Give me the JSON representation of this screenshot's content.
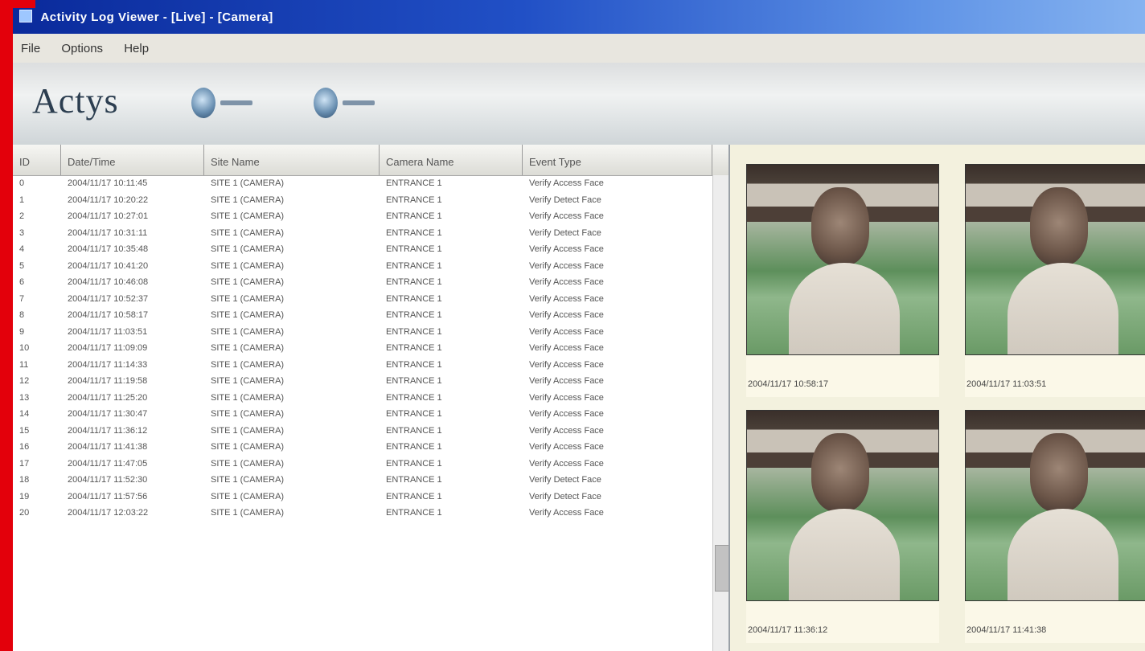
{
  "window": {
    "title": "Activity Log Viewer - [Live] - [Camera]"
  },
  "menu": [
    "File",
    "Options",
    "Help"
  ],
  "toolbar": {
    "logo": "Actys"
  },
  "columns": [
    "ID",
    "Date/Time",
    "Site Name",
    "Camera Name",
    "Event Type"
  ],
  "rows": [
    {
      "id": "0",
      "datetime": "2004/11/17 10:11:45",
      "site": "SITE 1 (CAMERA)",
      "camera": "ENTRANCE 1",
      "event": "Verify Access Face"
    },
    {
      "id": "1",
      "datetime": "2004/11/17 10:20:22",
      "site": "SITE 1 (CAMERA)",
      "camera": "ENTRANCE 1",
      "event": "Verify Detect Face"
    },
    {
      "id": "2",
      "datetime": "2004/11/17 10:27:01",
      "site": "SITE 1 (CAMERA)",
      "camera": "ENTRANCE 1",
      "event": "Verify Access Face"
    },
    {
      "id": "3",
      "datetime": "2004/11/17 10:31:11",
      "site": "SITE 1 (CAMERA)",
      "camera": "ENTRANCE 1",
      "event": "Verify Detect Face"
    },
    {
      "id": "4",
      "datetime": "2004/11/17 10:35:48",
      "site": "SITE 1 (CAMERA)",
      "camera": "ENTRANCE 1",
      "event": "Verify Access Face"
    },
    {
      "id": "5",
      "datetime": "2004/11/17 10:41:20",
      "site": "SITE 1 (CAMERA)",
      "camera": "ENTRANCE 1",
      "event": "Verify Access Face"
    },
    {
      "id": "6",
      "datetime": "2004/11/17 10:46:08",
      "site": "SITE 1 (CAMERA)",
      "camera": "ENTRANCE 1",
      "event": "Verify Access Face"
    },
    {
      "id": "7",
      "datetime": "2004/11/17 10:52:37",
      "site": "SITE 1 (CAMERA)",
      "camera": "ENTRANCE 1",
      "event": "Verify Access Face"
    },
    {
      "id": "8",
      "datetime": "2004/11/17 10:58:17",
      "site": "SITE 1 (CAMERA)",
      "camera": "ENTRANCE 1",
      "event": "Verify Access Face"
    },
    {
      "id": "9",
      "datetime": "2004/11/17 11:03:51",
      "site": "SITE 1 (CAMERA)",
      "camera": "ENTRANCE 1",
      "event": "Verify Access Face"
    },
    {
      "id": "10",
      "datetime": "2004/11/17 11:09:09",
      "site": "SITE 1 (CAMERA)",
      "camera": "ENTRANCE 1",
      "event": "Verify Access Face"
    },
    {
      "id": "11",
      "datetime": "2004/11/17 11:14:33",
      "site": "SITE 1 (CAMERA)",
      "camera": "ENTRANCE 1",
      "event": "Verify Access Face"
    },
    {
      "id": "12",
      "datetime": "2004/11/17 11:19:58",
      "site": "SITE 1 (CAMERA)",
      "camera": "ENTRANCE 1",
      "event": "Verify Access Face"
    },
    {
      "id": "13",
      "datetime": "2004/11/17 11:25:20",
      "site": "SITE 1 (CAMERA)",
      "camera": "ENTRANCE 1",
      "event": "Verify Access Face"
    },
    {
      "id": "14",
      "datetime": "2004/11/17 11:30:47",
      "site": "SITE 1 (CAMERA)",
      "camera": "ENTRANCE 1",
      "event": "Verify Access Face"
    },
    {
      "id": "15",
      "datetime": "2004/11/17 11:36:12",
      "site": "SITE 1 (CAMERA)",
      "camera": "ENTRANCE 1",
      "event": "Verify Access Face"
    },
    {
      "id": "16",
      "datetime": "2004/11/17 11:41:38",
      "site": "SITE 1 (CAMERA)",
      "camera": "ENTRANCE 1",
      "event": "Verify Access Face"
    },
    {
      "id": "17",
      "datetime": "2004/11/17 11:47:05",
      "site": "SITE 1 (CAMERA)",
      "camera": "ENTRANCE 1",
      "event": "Verify Access Face"
    },
    {
      "id": "18",
      "datetime": "2004/11/17 11:52:30",
      "site": "SITE 1 (CAMERA)",
      "camera": "ENTRANCE 1",
      "event": "Verify Detect Face"
    },
    {
      "id": "19",
      "datetime": "2004/11/17 11:57:56",
      "site": "SITE 1 (CAMERA)",
      "camera": "ENTRANCE 1",
      "event": "Verify Detect Face"
    },
    {
      "id": "20",
      "datetime": "2004/11/17 12:03:22",
      "site": "SITE 1 (CAMERA)",
      "camera": "ENTRANCE 1",
      "event": "Verify Access Face"
    }
  ],
  "thumbnails": [
    {
      "caption": "2004/11/17 10:58:17"
    },
    {
      "caption": "2004/11/17 11:03:51"
    },
    {
      "caption": "2004/11/17 11:36:12"
    },
    {
      "caption": "2004/11/17 11:41:38"
    }
  ]
}
